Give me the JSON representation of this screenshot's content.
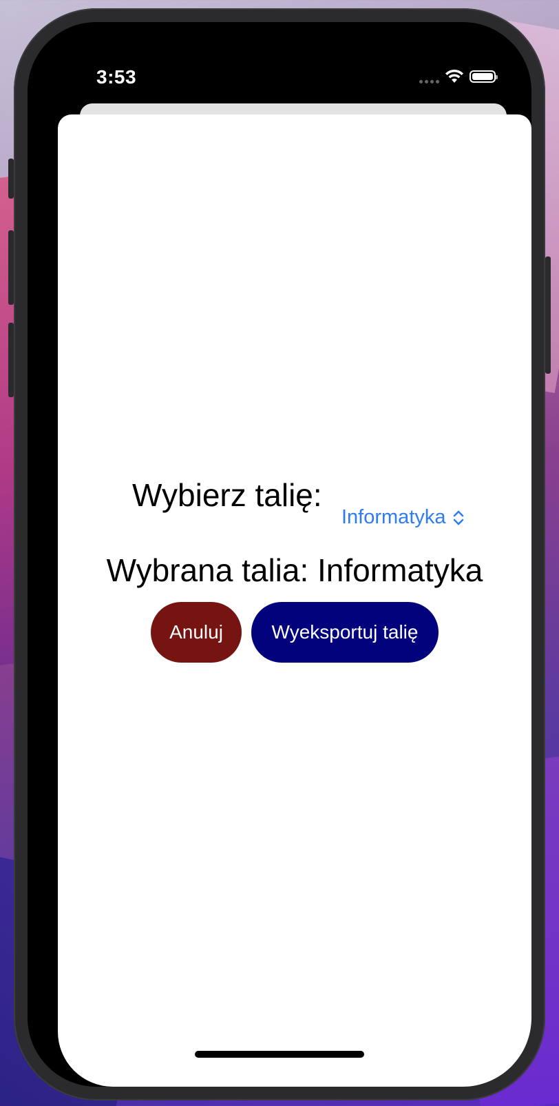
{
  "status_bar": {
    "time": "3:53",
    "icons": [
      "cellular-signal-icon",
      "wifi-icon",
      "battery-icon"
    ]
  },
  "picker": {
    "label": "Wybierz talię:",
    "value": "Informatyka",
    "icon": "chevron-up-down-icon"
  },
  "selected": {
    "text": "Wybrana talia: Informatyka"
  },
  "actions": {
    "cancel_label": "Anuluj",
    "export_label": "Wyeksportuj talię"
  },
  "colors": {
    "accent": "#2f7bf0",
    "cancel_button": "#761411",
    "export_button": "#02037c"
  }
}
